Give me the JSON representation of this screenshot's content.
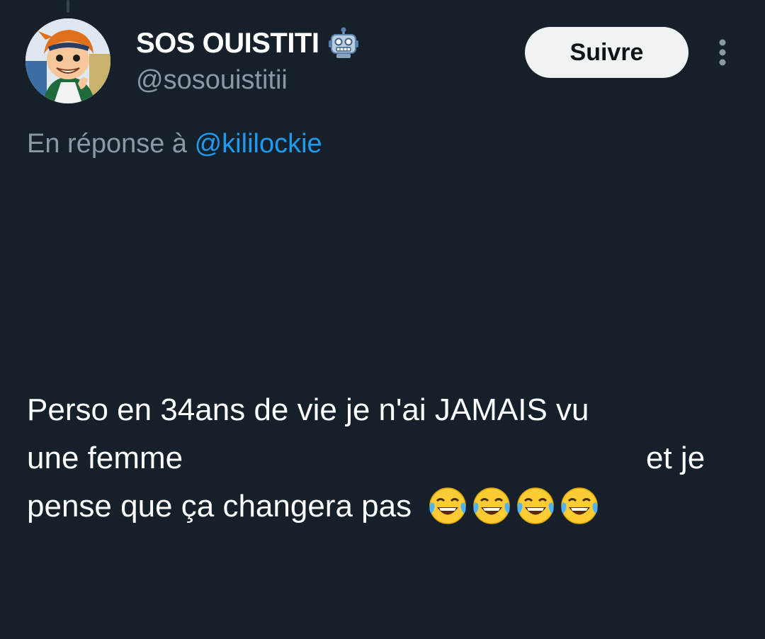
{
  "author": {
    "display_name": "SOS OUISTITI",
    "badge_icon": "robot-icon",
    "handle": "@sosouistitii"
  },
  "actions": {
    "follow_label": "Suivre",
    "more_icon": "more-vertical-icon"
  },
  "reply_context": {
    "prefix": "En réponse à ",
    "mention": "@kililockie"
  },
  "tweet": {
    "line1": "Perso en 34ans de vie je n'ai JAMAIS vu",
    "line2_start": "une femme",
    "line2_end": "et je",
    "line3": "pense que ça changera pas",
    "emojis": [
      "face-with-tears-of-joy",
      "face-with-tears-of-joy",
      "face-with-tears-of-joy",
      "face-with-tears-of-joy"
    ]
  },
  "colors": {
    "background": "#15202b",
    "text_primary": "#ffffff",
    "text_secondary": "#8b98a5",
    "link": "#1d9bf0",
    "follow_bg": "#eff3f4",
    "follow_text": "#0f1419"
  }
}
